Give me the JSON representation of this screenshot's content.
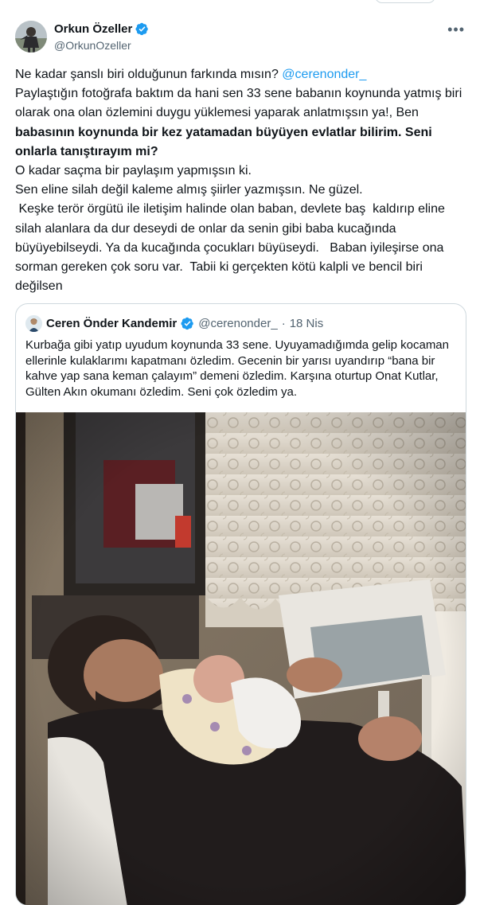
{
  "author": {
    "name": "Orkun Özeller",
    "handle": "@OrkunOzeller",
    "verified": true
  },
  "tweet": {
    "line1_text": "Ne kadar şanslı biri olduğunun farkında mısın? ",
    "line1_mention": "@cerenonder_",
    "para1": "Paylaştığın fotoğrafa baktım da hani sen 33 sene babanın koynunda yatmış biri olarak ona olan özlemini duygu yüklemesi yaparak anlatmışsın ya!, Ben ",
    "para1_bold": "babasının koynunda bir kez yatamadan büyüyen evlatlar bilirim. Seni onlarla tanıştırayım mi?",
    "para2": "O kadar  saçma bir paylaşım yapmışsın ki.",
    "para3": "Sen eline silah değil kaleme almış şiirler yazmışsın.  Ne güzel.",
    "para4": " Keşke terör örgütü ile iletişim halinde olan baban, devlete baş  kaldırıp eline silah alanlara da dur deseydi de onlar da senin gibi baba kucağında büyüyebilseydi. Ya da kucağında çocukları büyüseydi.   Baban iyileşirse ona sorman gereken çok soru var.  Tabii ki gerçekten kötü kalpli ve bencil biri değilsen"
  },
  "quote": {
    "name": "Ceren Önder Kandemir",
    "handle": "@cerenonder_",
    "separator": "·",
    "date": "18 Nis",
    "verified": true,
    "text": "Kurbağa gibi yatıp uyudum koynunda 33 sene. Uyuyamadığımda gelip kocaman ellerinle kulaklarımı kapatmanı özledim. Gecenin bir yarısı uyandırıp “bana bir kahve yap sana keman çalayım” demeni özledim. Karşına oturtup Onat Kutlar, Gülten Akın okumanı özledim. Seni çok özledim ya."
  },
  "icons": {
    "verified": "verified-badge-icon",
    "more": "more-options-icon"
  },
  "colors": {
    "accent": "#1d9bf0",
    "text": "#0f1419",
    "secondary": "#536471",
    "border": "#cfd9de"
  }
}
